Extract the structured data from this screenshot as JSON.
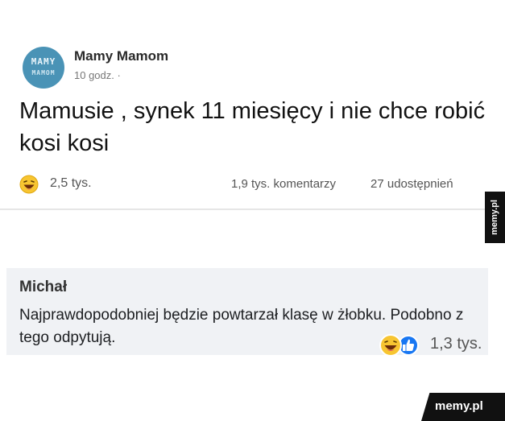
{
  "post": {
    "avatar_line1": "MAMY",
    "avatar_line2": "MAMOM",
    "page_name": "Mamy Mamom",
    "time": "10 godz. ·",
    "text": "Mamusie , synek 11 miesięcy i nie chce robić kosi kosi",
    "reaction_icon": "laughing-emoji-icon",
    "reaction_count": "2,5 tys.",
    "comments": "1,9 tys. komentarzy",
    "shares": "27 udostępnień"
  },
  "comment": {
    "author": "Michał",
    "text": "Najprawdopodobniej będzie powtarzał klasę w żłobku. Podobno z tego odpytują.",
    "reaction_icons": [
      "laughing-emoji-icon",
      "like-thumb-icon"
    ],
    "reaction_count": "1,3 tys."
  },
  "watermark": {
    "side": "memy.pl",
    "footer": "memy.pl"
  },
  "colors": {
    "avatar": "#4a93b6",
    "comment_bg": "#f0f2f5",
    "like_blue": "#1877f2",
    "emoji_yellow": "#f7c531",
    "watermark_bg": "#111111"
  }
}
